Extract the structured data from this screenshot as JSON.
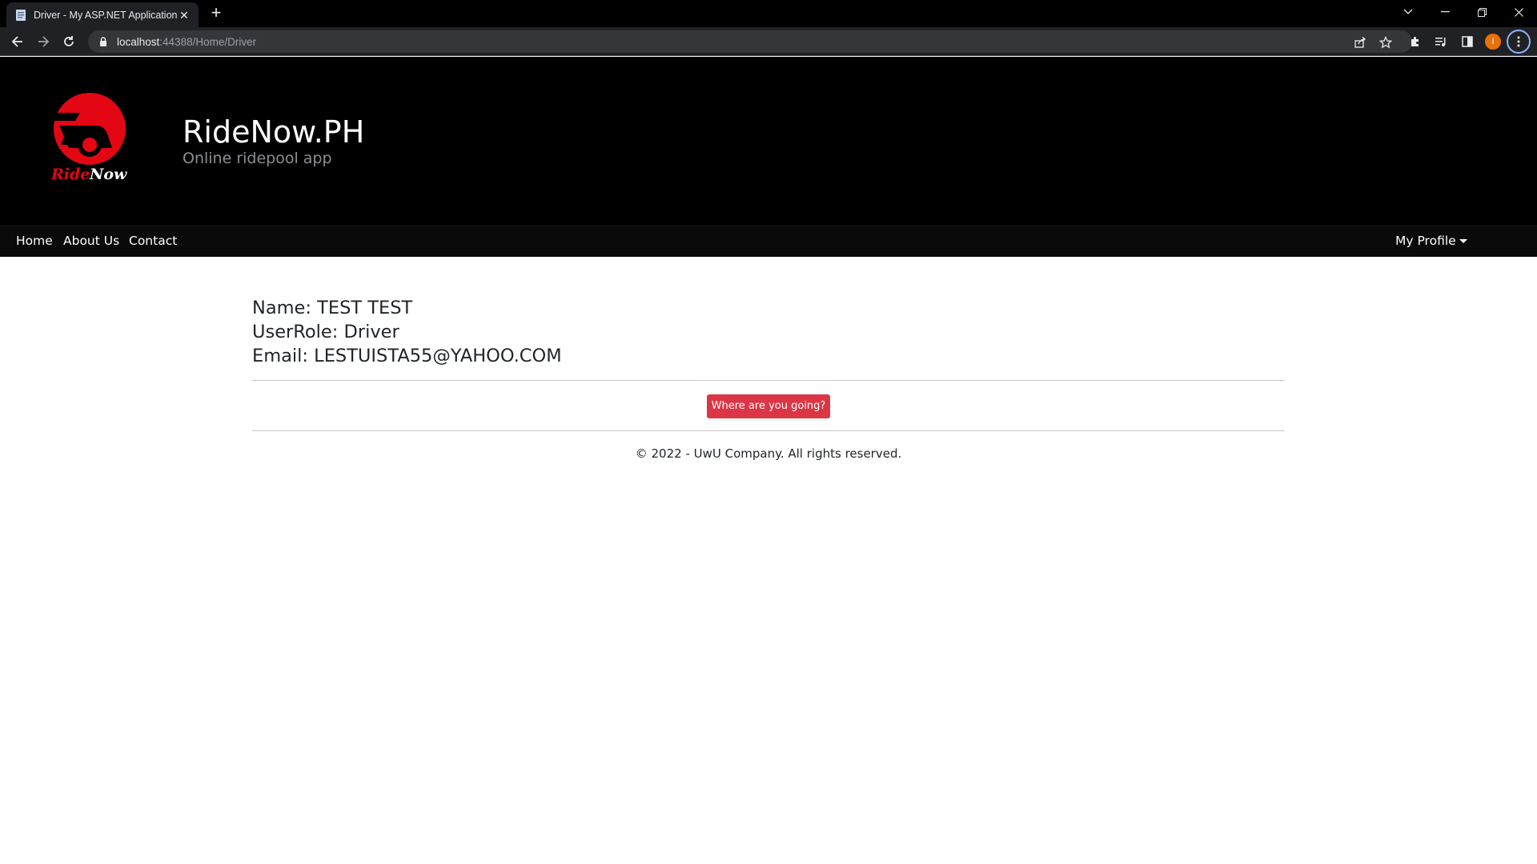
{
  "browser": {
    "tab_title": "Driver - My ASP.NET Application",
    "url_host": "localhost",
    "url_rest": ":44388/Home/Driver",
    "profile_initial": "I"
  },
  "header": {
    "brand_title": "RideNow.PH",
    "brand_subtitle": "Online ridepool app",
    "logo_text": "RideNow",
    "accent": "#e30613"
  },
  "navbar": {
    "links": [
      "Home",
      "About Us",
      "Contact"
    ],
    "profile_label": "My Profile"
  },
  "profile": {
    "name_line": "Name: TEST TEST",
    "role_line": "UserRole: Driver",
    "email_line": "Email: LESTUISTA55@YAHOO.COM"
  },
  "action": {
    "button_label": "Where are you going?",
    "button_color": "#dc3545"
  },
  "footer": {
    "text": "© 2022 - UwU Company. All rights reserved."
  }
}
